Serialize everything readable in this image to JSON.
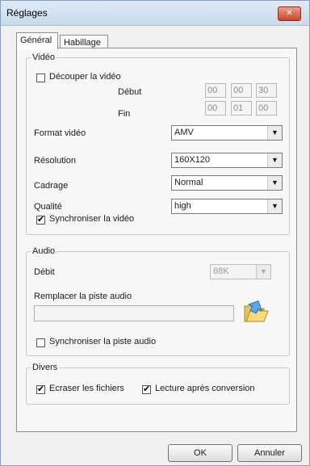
{
  "window": {
    "title": "Réglages",
    "close_label": "✕"
  },
  "tabs": [
    {
      "label": "Général"
    },
    {
      "label": "Habillage"
    }
  ],
  "video": {
    "legend": "Vidéo",
    "cut_label": "Découper la vidéo",
    "cut_checked": false,
    "start_label": "Début",
    "start": [
      "00",
      "00",
      "30"
    ],
    "end_label": "Fin",
    "end": [
      "00",
      "01",
      "00"
    ],
    "format_label": "Format vidéo",
    "format_value": "AMV",
    "resolution_label": "Résolution",
    "resolution_value": "160X120",
    "framing_label": "Cadrage",
    "framing_value": "Normal",
    "quality_label": "Qualité",
    "quality_value": "high",
    "sync_label": "Synchroniser la vidéo",
    "sync_checked": true
  },
  "audio": {
    "legend": "Audio",
    "bitrate_label": "Débit",
    "bitrate_value": "88K",
    "replace_label": "Remplacer la piste audio",
    "replace_value": "",
    "sync_label": "Synchroniser la piste audio",
    "sync_checked": false
  },
  "misc": {
    "legend": "Divers",
    "overwrite_label": "Ecraser les fichiers",
    "overwrite_checked": true,
    "play_after_label": "Lecture après conversion",
    "play_after_checked": true
  },
  "buttons": {
    "ok": "OK",
    "cancel": "Annuler"
  },
  "check_mark": "✔",
  "arrow_glyph": "▼"
}
